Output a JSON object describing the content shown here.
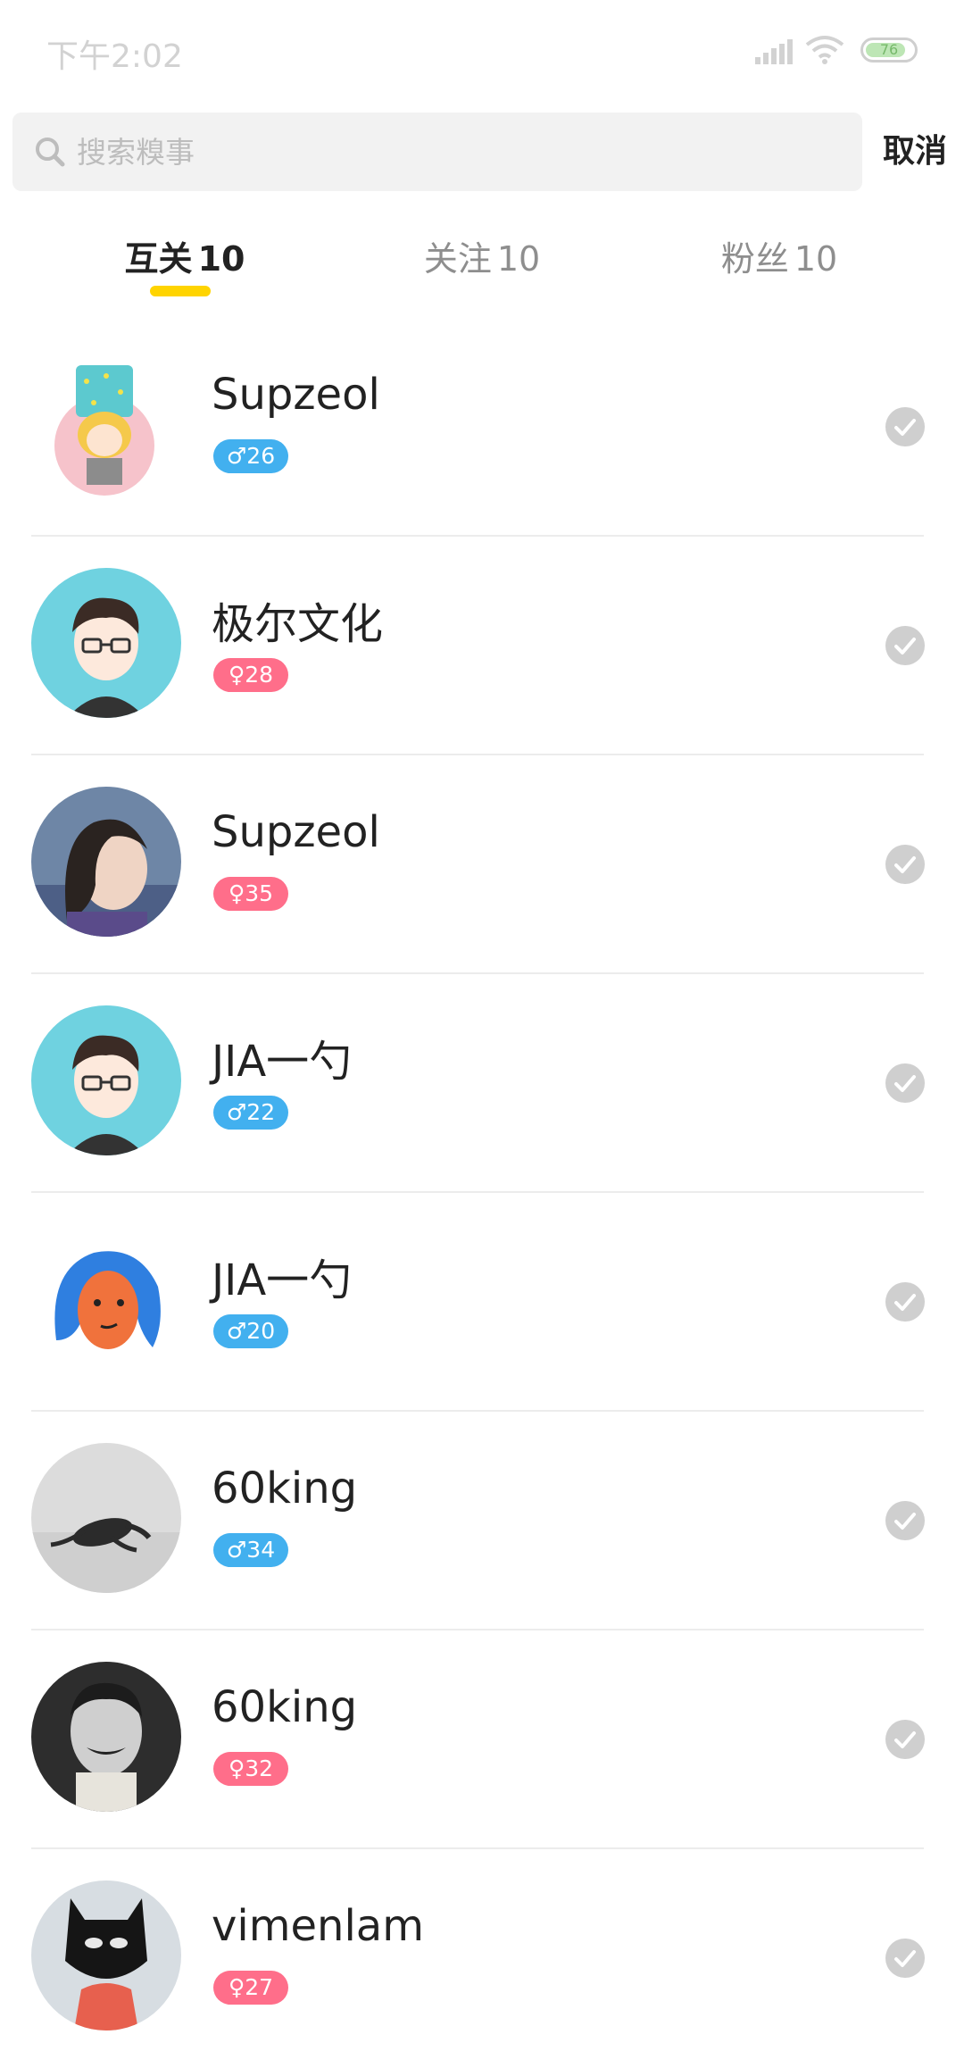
{
  "status_bar": {
    "time": "下午2:02",
    "battery": "76"
  },
  "search": {
    "placeholder": "搜索糗事",
    "value": "",
    "cancel_label": "取消"
  },
  "tabs": [
    {
      "label": "互关",
      "count": "10",
      "active": true
    },
    {
      "label": "关注",
      "count": "10",
      "active": false
    },
    {
      "label": "粉丝",
      "count": "10",
      "active": false
    }
  ],
  "users": [
    {
      "name": "Supzeol",
      "gender": "male",
      "gender_symbol": "♂",
      "age": "26",
      "avatar": "cartoon-girl-bucket"
    },
    {
      "name": "极尔文化",
      "gender": "female",
      "gender_symbol": "♀",
      "age": "28",
      "avatar": "cartoon-boy-glasses"
    },
    {
      "name": "Supzeol",
      "gender": "female",
      "gender_symbol": "♀",
      "age": "35",
      "avatar": "photo-girl-profile"
    },
    {
      "name": "JIA一勺",
      "gender": "male",
      "gender_symbol": "♂",
      "age": "22",
      "avatar": "cartoon-boy-glasses"
    },
    {
      "name": "JIA一勺",
      "gender": "male",
      "gender_symbol": "♂",
      "age": "20",
      "avatar": "cartoon-blue-hair-girl"
    },
    {
      "name": "60king",
      "gender": "male",
      "gender_symbol": "♂",
      "age": "34",
      "avatar": "photo-turtle"
    },
    {
      "name": "60king",
      "gender": "female",
      "gender_symbol": "♀",
      "age": "32",
      "avatar": "photo-man-portrait"
    },
    {
      "name": "vimenlam",
      "gender": "female",
      "gender_symbol": "♀",
      "age": "27",
      "avatar": "photo-masked-person"
    }
  ],
  "colors": {
    "tab_underline": "#ffd400",
    "male_badge": "#42b0ef",
    "female_badge": "#ff6e8a",
    "check": "#cfcfcf"
  }
}
